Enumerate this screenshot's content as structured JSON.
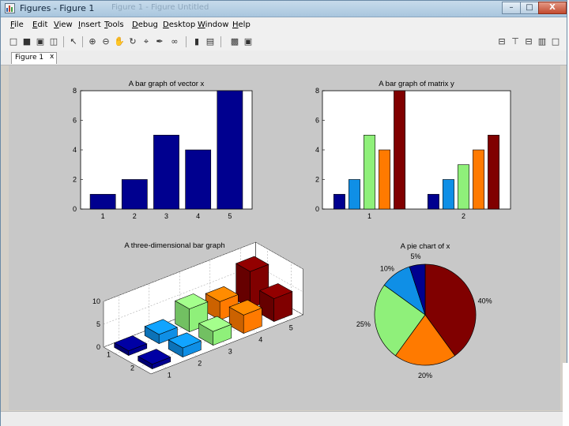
{
  "window": {
    "title": "Figures - Figure 1",
    "ghost_title": "Figure 1 - Figure Untitled",
    "controls": {
      "minimize": "–",
      "maximize": "□",
      "close": "X"
    }
  },
  "menubar": {
    "items": [
      "File",
      "Edit",
      "View",
      "Insert",
      "Tools",
      "Debug",
      "Desktop",
      "Window",
      "Help"
    ]
  },
  "toolbar": {
    "left_icons": [
      "new-file-icon",
      "open-folder-icon",
      "save-icon",
      "print-icon",
      "pointer-icon",
      "zoom-in-icon",
      "zoom-out-icon",
      "pan-icon",
      "rotate-icon",
      "data-cursor-icon",
      "brush-icon",
      "link-icon",
      "colorbar-icon",
      "legend-icon",
      "hide-plot-tools-icon",
      "show-plot-tools-icon"
    ],
    "right_icons": [
      "tile-icon",
      "split-icon",
      "float-icon",
      "dock-icon",
      "undock-icon"
    ]
  },
  "tabs": [
    {
      "label": "Figure 1",
      "close": "x"
    }
  ],
  "colors": {
    "navy": "#00008f",
    "blue": "#0f8fe6",
    "lightgreen": "#8ff07a",
    "orange": "#ff7a00",
    "darkred": "#800000",
    "figure_bg": "#c8c8c8"
  },
  "chart_data": [
    {
      "type": "bar",
      "title": "A bar graph of vector x",
      "categories": [
        "1",
        "2",
        "3",
        "4",
        "5"
      ],
      "values": [
        1,
        2,
        5,
        4,
        8
      ],
      "ylim": [
        0,
        8
      ],
      "yticks": [
        "0",
        "2",
        "4",
        "6",
        "8"
      ],
      "color": "#00008f"
    },
    {
      "type": "bar",
      "title": "A bar graph of matrix y",
      "categories": [
        "1",
        "2"
      ],
      "series": [
        {
          "values": [
            1,
            1
          ],
          "color": "#00008f"
        },
        {
          "values": [
            2,
            2
          ],
          "color": "#0f8fe6"
        },
        {
          "values": [
            5,
            3
          ],
          "color": "#8ff07a"
        },
        {
          "values": [
            4,
            4
          ],
          "color": "#ff7a00"
        },
        {
          "values": [
            8,
            5
          ],
          "color": "#800000"
        }
      ],
      "ylim": [
        0,
        8
      ],
      "yticks": [
        "0",
        "2",
        "4",
        "6",
        "8"
      ]
    },
    {
      "type": "bar",
      "title": "A three-dimensional bar graph",
      "x_ticks": [
        "1",
        "2",
        "3",
        "4",
        "5"
      ],
      "y_ticks": [
        "1",
        "2"
      ],
      "z_ticks": [
        "0",
        "5",
        "10"
      ],
      "zlim": [
        0,
        10
      ],
      "rows": [
        {
          "values": [
            1,
            2,
            5,
            4,
            8
          ]
        },
        {
          "values": [
            1,
            2,
            3,
            4,
            5
          ]
        }
      ],
      "colors": [
        "#00008f",
        "#0f8fe6",
        "#8ff07a",
        "#ff7a00",
        "#800000"
      ]
    },
    {
      "type": "pie",
      "title": "A pie chart of x",
      "slices": [
        {
          "label": "40%",
          "value": 40,
          "color": "#800000"
        },
        {
          "label": "20%",
          "value": 20,
          "color": "#ff7a00"
        },
        {
          "label": "25%",
          "value": 25,
          "color": "#8ff07a"
        },
        {
          "label": "10%",
          "value": 10,
          "color": "#0f8fe6"
        },
        {
          "label": "5%",
          "value": 5,
          "color": "#00008f"
        }
      ]
    }
  ]
}
